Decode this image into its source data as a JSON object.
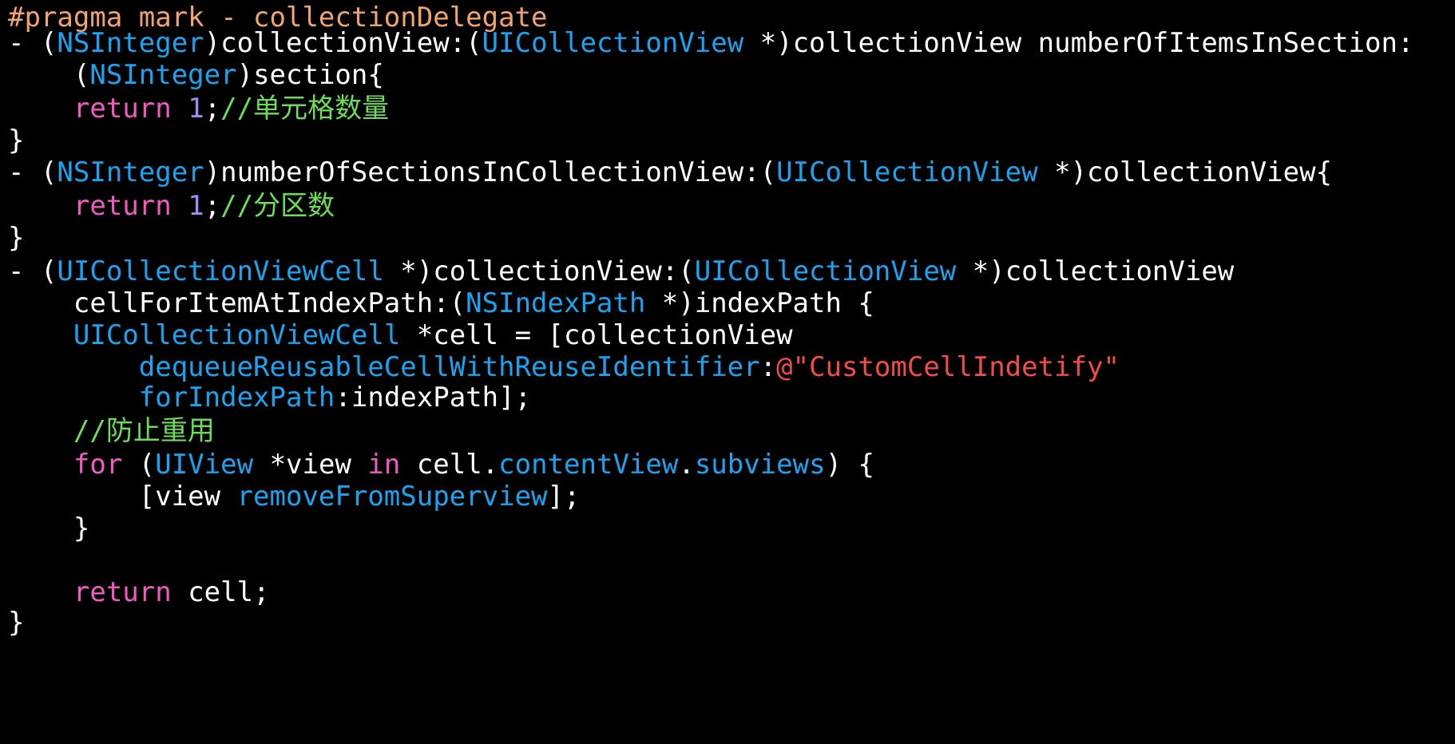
{
  "editor": {
    "background": "#000000",
    "colors": {
      "plain": "#ffffff",
      "pragma": "#f3a46c",
      "type": "#19a4f1",
      "keyword": "#f05ac2",
      "number": "#9d8df6",
      "comment": "#6bde56",
      "string": "#f44a48",
      "method": "#19a4f1"
    },
    "lines": [
      {
        "tokens": [
          {
            "t": "#pragma mark - collectionDelegate",
            "k": "pragma"
          }
        ]
      },
      {
        "tokens": [
          {
            "t": "- (",
            "k": "plain"
          },
          {
            "t": "NSInteger",
            "k": "type"
          },
          {
            "t": ")collectionView:(",
            "k": "plain"
          },
          {
            "t": "UICollectionView",
            "k": "type"
          },
          {
            "t": " *)collectionView numberOfItemsInSection:",
            "k": "plain"
          }
        ]
      },
      {
        "tokens": [
          {
            "t": "    (",
            "k": "plain"
          },
          {
            "t": "NSInteger",
            "k": "type"
          },
          {
            "t": ")section{",
            "k": "plain"
          }
        ]
      },
      {
        "tokens": [
          {
            "t": "    ",
            "k": "plain"
          },
          {
            "t": "return",
            "k": "keyword"
          },
          {
            "t": " ",
            "k": "plain"
          },
          {
            "t": "1",
            "k": "number"
          },
          {
            "t": ";",
            "k": "plain"
          },
          {
            "t": "//单元格数量",
            "k": "comment"
          }
        ]
      },
      {
        "tokens": [
          {
            "t": "}",
            "k": "plain"
          }
        ]
      },
      {
        "tokens": [
          {
            "t": "- (",
            "k": "plain"
          },
          {
            "t": "NSInteger",
            "k": "type"
          },
          {
            "t": ")numberOfSectionsInCollectionView:(",
            "k": "plain"
          },
          {
            "t": "UICollectionView",
            "k": "type"
          },
          {
            "t": " *)collectionView{",
            "k": "plain"
          }
        ]
      },
      {
        "tokens": [
          {
            "t": "    ",
            "k": "plain"
          },
          {
            "t": "return",
            "k": "keyword"
          },
          {
            "t": " ",
            "k": "plain"
          },
          {
            "t": "1",
            "k": "number"
          },
          {
            "t": ";",
            "k": "plain"
          },
          {
            "t": "//分区数",
            "k": "comment"
          }
        ]
      },
      {
        "tokens": [
          {
            "t": "}",
            "k": "plain"
          }
        ]
      },
      {
        "tokens": [
          {
            "t": "- (",
            "k": "plain"
          },
          {
            "t": "UICollectionViewCell",
            "k": "type"
          },
          {
            "t": " *)collectionView:(",
            "k": "plain"
          },
          {
            "t": "UICollectionView",
            "k": "type"
          },
          {
            "t": " *)collectionView",
            "k": "plain"
          }
        ]
      },
      {
        "tokens": [
          {
            "t": "    cellForItemAtIndexPath:(",
            "k": "plain"
          },
          {
            "t": "NSIndexPath",
            "k": "type"
          },
          {
            "t": " *)indexPath {",
            "k": "plain"
          }
        ]
      },
      {
        "tokens": [
          {
            "t": "    ",
            "k": "plain"
          },
          {
            "t": "UICollectionViewCell",
            "k": "type"
          },
          {
            "t": " *cell = [collectionView",
            "k": "plain"
          }
        ]
      },
      {
        "tokens": [
          {
            "t": "        ",
            "k": "plain"
          },
          {
            "t": "dequeueReusableCellWithReuseIdentifier",
            "k": "method"
          },
          {
            "t": ":",
            "k": "plain"
          },
          {
            "t": "@\"CustomCellIndetify\"",
            "k": "string"
          }
        ]
      },
      {
        "tokens": [
          {
            "t": "        ",
            "k": "plain"
          },
          {
            "t": "forIndexPath",
            "k": "method"
          },
          {
            "t": ":indexPath];",
            "k": "plain"
          }
        ]
      },
      {
        "tokens": [
          {
            "t": "    ",
            "k": "plain"
          },
          {
            "t": "//防止重用",
            "k": "comment"
          }
        ]
      },
      {
        "tokens": [
          {
            "t": "    ",
            "k": "plain"
          },
          {
            "t": "for",
            "k": "keyword"
          },
          {
            "t": " (",
            "k": "plain"
          },
          {
            "t": "UIView",
            "k": "type"
          },
          {
            "t": " *view ",
            "k": "plain"
          },
          {
            "t": "in",
            "k": "keyword"
          },
          {
            "t": " cell.",
            "k": "plain"
          },
          {
            "t": "contentView",
            "k": "method"
          },
          {
            "t": ".",
            "k": "plain"
          },
          {
            "t": "subviews",
            "k": "method"
          },
          {
            "t": ") {",
            "k": "plain"
          }
        ]
      },
      {
        "tokens": [
          {
            "t": "        [view ",
            "k": "plain"
          },
          {
            "t": "removeFromSuperview",
            "k": "method"
          },
          {
            "t": "];",
            "k": "plain"
          }
        ]
      },
      {
        "tokens": [
          {
            "t": "    }",
            "k": "plain"
          }
        ]
      },
      {
        "tokens": []
      },
      {
        "tokens": [
          {
            "t": "    ",
            "k": "plain"
          },
          {
            "t": "return",
            "k": "keyword"
          },
          {
            "t": " cell;",
            "k": "plain"
          }
        ]
      },
      {
        "tokens": [
          {
            "t": "}",
            "k": "plain"
          }
        ]
      }
    ]
  }
}
